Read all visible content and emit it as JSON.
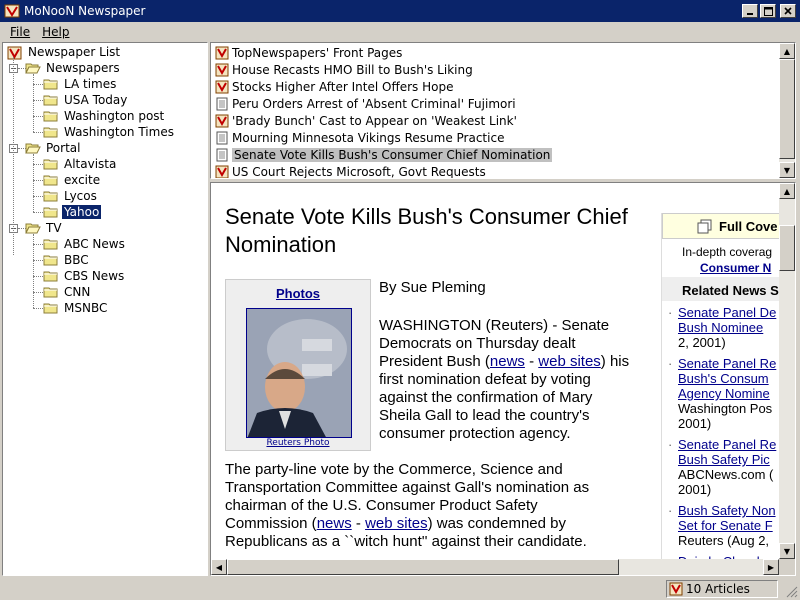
{
  "window": {
    "title": "MoNooN Newspaper"
  },
  "menu": {
    "file": "File",
    "help": "Help"
  },
  "tree": {
    "root": "Newspaper List",
    "groups": [
      {
        "label": "Newspapers",
        "items": [
          "LA times",
          "USA Today",
          "Washington post",
          "Washington Times"
        ]
      },
      {
        "label": "Portal",
        "items": [
          "Altavista",
          "excite",
          "Lycos",
          "Yahoo"
        ]
      },
      {
        "label": "TV",
        "items": [
          "ABC News",
          "BBC",
          "CBS News",
          "CNN",
          "MSNBC"
        ]
      }
    ],
    "selected": "Yahoo"
  },
  "headlines": [
    {
      "text": "TopNewspapers' Front Pages",
      "icon": "news-icon"
    },
    {
      "text": "House Recasts HMO Bill to Bush's Liking",
      "icon": "news-icon"
    },
    {
      "text": "Stocks Higher After Intel Offers Hope",
      "icon": "news-icon"
    },
    {
      "text": "Peru Orders Arrest of 'Absent Criminal' Fujimori",
      "icon": "page-icon"
    },
    {
      "text": "'Brady Bunch' Cast to Appear on 'Weakest Link'",
      "icon": "news-icon"
    },
    {
      "text": "Mourning Minnesota Vikings Resume Practice",
      "icon": "page-icon"
    },
    {
      "text": "Senate Vote Kills Bush's Consumer Chief Nomination",
      "icon": "page-icon",
      "selected": true
    },
    {
      "text": "US Court Rejects Microsoft, Govt Requests",
      "icon": "news-icon"
    }
  ],
  "article": {
    "title": "Senate Vote Kills Bush's Consumer Chief Nomination",
    "photos_label": "Photos",
    "photo_caption": "Reuters Photo",
    "byline": "By Sue Pleming",
    "p1": [
      {
        "t": "WASHINGTON (Reuters) - Senate"
      },
      {
        "t": "Democrats on Thursday dealt"
      },
      {
        "parts": [
          {
            "t": "President Bush ("
          },
          {
            "t": "news",
            "link": true
          },
          {
            "t": " - "
          },
          {
            "t": "web sites",
            "link": true
          },
          {
            "t": ") his"
          }
        ]
      },
      {
        "t": "first nomination defeat by voting"
      },
      {
        "t": "against the confirmation of Mary"
      },
      {
        "t": "Sheila Gall to lead the country's"
      },
      {
        "t": "consumer protection agency."
      }
    ],
    "p2": [
      {
        "t": "The party-line vote by the Commerce, Science and"
      },
      {
        "t": "Transportation Committee against Gall's nomination as"
      },
      {
        "t": "chairman of the U.S. Consumer Product Safety"
      },
      {
        "parts": [
          {
            "t": "Commission ("
          },
          {
            "t": "news",
            "link": true
          },
          {
            "t": " - "
          },
          {
            "t": "web sites",
            "link": true
          },
          {
            "t": ") was condemned by"
          }
        ]
      },
      {
        "t": "Republicans as a ``witch hunt'' against their candidate."
      }
    ]
  },
  "sidebar": {
    "header": "Full Cove",
    "sub1": "In-depth coverag",
    "sub2": "Consumer N",
    "related": "Related News S",
    "items": [
      {
        "lines": [
          {
            "t": "Senate Panel De",
            "link": true
          },
          {
            "t": "Bush Nominee",
            "link": true
          },
          {
            "t": "2, 2001)"
          }
        ]
      },
      {
        "lines": [
          {
            "t": "Senate Panel Re",
            "link": true
          },
          {
            "t": "Bush's Consum",
            "link": true
          },
          {
            "t": "Agency Nomine",
            "link": true
          },
          {
            "t": "Washington Pos"
          },
          {
            "t": "2001)"
          }
        ]
      },
      {
        "lines": [
          {
            "t": "Senate Panel Re",
            "link": true
          },
          {
            "t": "Bush Safety Pic",
            "link": true
          },
          {
            "t": "ABCNews.com ("
          },
          {
            "t": "2001)"
          }
        ]
      },
      {
        "lines": [
          {
            "t": "Bush Safety Non",
            "link": true
          },
          {
            "t": "Set for Senate F",
            "link": true
          },
          {
            "t": "Reuters (Aug 2,"
          }
        ]
      },
      {
        "lines": [
          {
            "t": "DaimlerChrysler",
            "link": true
          }
        ]
      }
    ]
  },
  "status": {
    "count": "10 Articles"
  }
}
